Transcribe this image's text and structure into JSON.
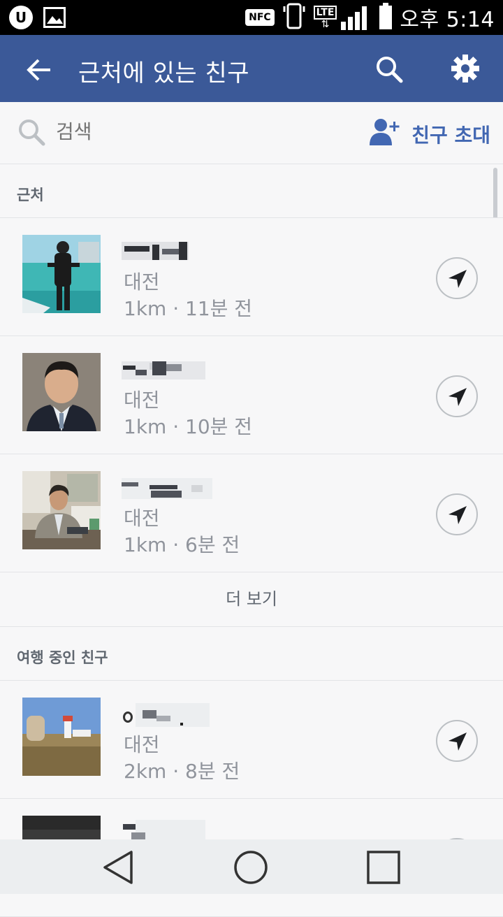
{
  "status_bar": {
    "carrier_icon": "u-plus-icon",
    "gallery_icon": "image-icon",
    "nfc_label": "NFC",
    "network": "LTE",
    "time": "오후 5:14"
  },
  "app_bar": {
    "title": "근처에 있는 친구"
  },
  "search": {
    "placeholder": "검색",
    "invite_label": "친구 초대"
  },
  "sections": {
    "nearby": {
      "title": "근처"
    },
    "traveling": {
      "title": "여행 중인 친구"
    }
  },
  "nearby_friends": [
    {
      "city": "대전",
      "distance": "1km · 11분 전"
    },
    {
      "city": "대전",
      "distance": "1km · 10분 전"
    },
    {
      "city": "대전",
      "distance": "1km · 6분 전"
    }
  ],
  "more_label": "더 보기",
  "traveling_friends": [
    {
      "city": "대전",
      "distance": "2km · 8분 전"
    }
  ],
  "colors": {
    "app_bar": "#3b5998",
    "accent": "#4267b2",
    "background": "#f7f7f8"
  }
}
